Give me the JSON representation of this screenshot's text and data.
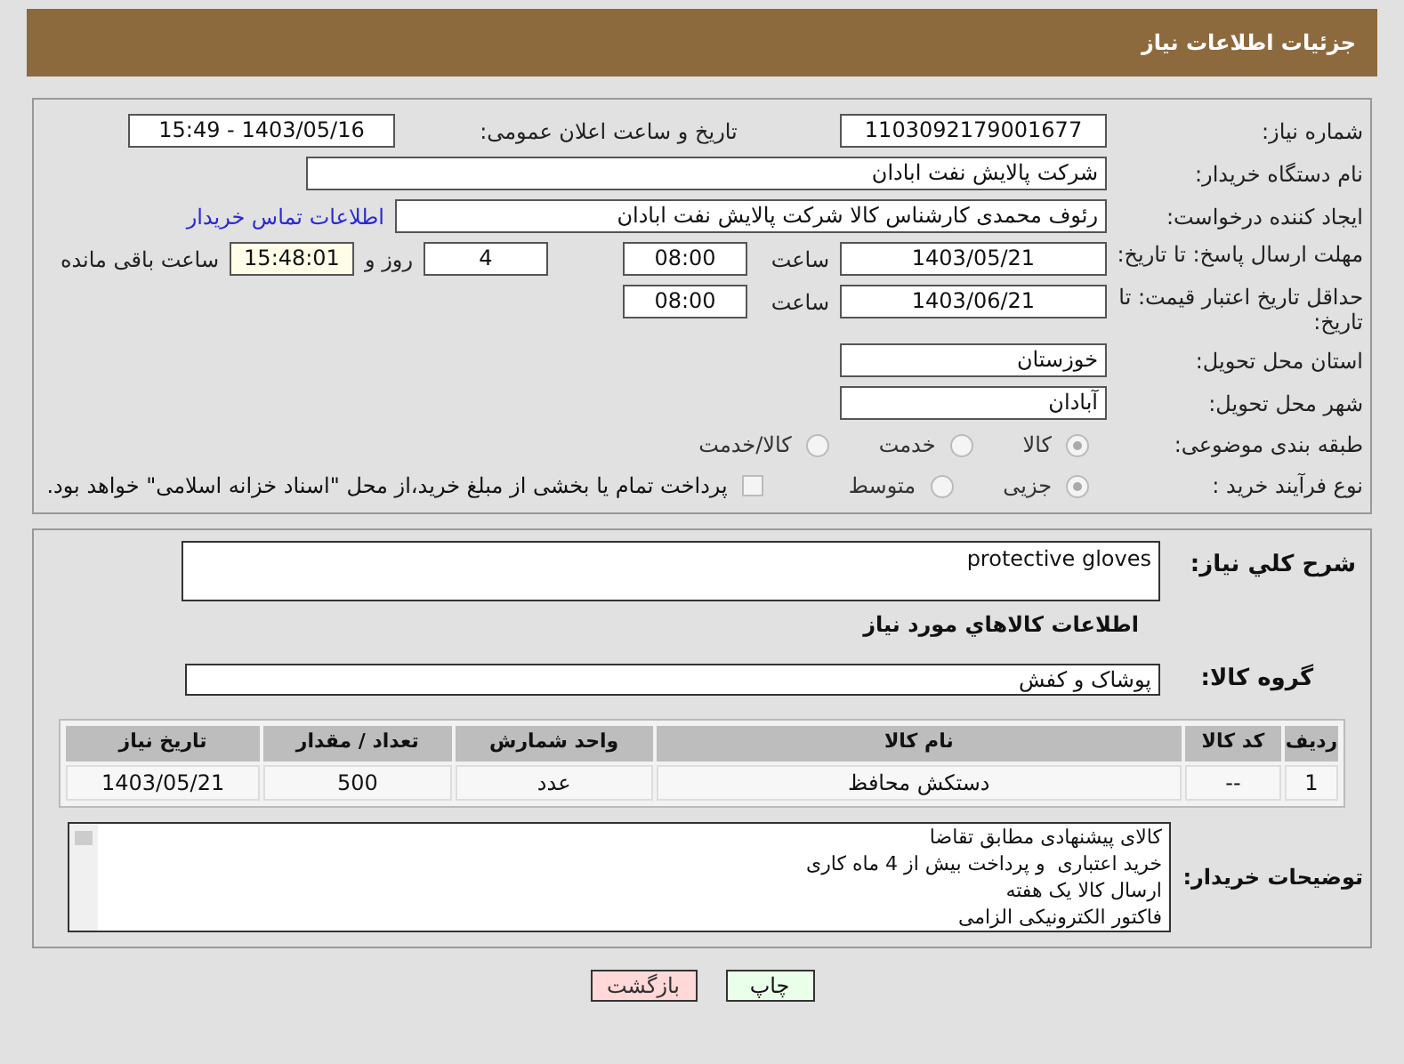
{
  "header": {
    "title": "جزئیات اطلاعات نیاز"
  },
  "details": {
    "need_number": {
      "label": "شماره نیاز:",
      "value": "1103092179001677"
    },
    "announce": {
      "label": "تاریخ و ساعت اعلان عمومی:",
      "value": "1403/05/16 - 15:49"
    },
    "buyer": {
      "label": "نام دستگاه خریدار:",
      "value": "شرکت پالایش نفت ابادان"
    },
    "creator": {
      "label": "ایجاد کننده درخواست:",
      "value": "رئوف محمدی کارشناس کالا شرکت پالایش نفت ابادان",
      "link": "اطلاعات تماس خریدار"
    },
    "deadline": {
      "label": "مهلت ارسال پاسخ: تا تاریخ:",
      "date": "1403/05/21",
      "time_label": "ساعت",
      "time": "08:00",
      "days": "4",
      "days_label": "روز و",
      "remaining": "15:48:01",
      "remaining_label": "ساعت باقی مانده"
    },
    "validity": {
      "label": "حداقل تاریخ اعتبار قیمت: تا تاریخ:",
      "date": "1403/06/21",
      "time_label": "ساعت",
      "time": "08:00"
    },
    "province": {
      "label": "استان محل تحویل:",
      "value": "خوزستان"
    },
    "city": {
      "label": "شهر محل تحویل:",
      "value": "آبادان"
    },
    "category": {
      "label": "طبقه بندی موضوعی:",
      "options": [
        {
          "label": "کالا",
          "selected": true
        },
        {
          "label": "خدمت",
          "selected": false
        },
        {
          "label": "کالا/خدمت",
          "selected": false
        }
      ]
    },
    "process": {
      "label": "نوع فرآیند خرید :",
      "options": [
        {
          "label": "جزیی",
          "selected": true
        },
        {
          "label": "متوسط",
          "selected": false
        }
      ],
      "treasury": {
        "label": "پرداخت تمام یا بخشی از مبلغ خرید،از محل \"اسناد خزانه اسلامی\" خواهد بود.",
        "checked": false
      }
    }
  },
  "items": {
    "description": {
      "label": "شرح كلي نياز:",
      "value": "protective gloves"
    },
    "heading": "اطلاعات كالاهاي مورد نياز",
    "group": {
      "label": "گروه کالا:",
      "value": "پوشاک و کفش"
    },
    "table": {
      "columns": [
        "ردیف",
        "کد کالا",
        "نام کالا",
        "واحد شمارش",
        "تعداد / مقدار",
        "تاریخ نیاز"
      ],
      "rows": [
        [
          "1",
          "--",
          "دستکش محافظ",
          "عدد",
          "500",
          "1403/05/21"
        ]
      ]
    },
    "notes": {
      "label": "توضیحات خریدار:",
      "lines": [
        "کالای پیشنهادی مطابق تقاضا",
        "خرید اعتباری  و پرداخت بیش از 4 ماه کاری",
        "ارسال کالا یک هفته",
        "فاکتور الکترونیکی الزامی"
      ]
    }
  },
  "buttons": [
    {
      "label": "چاپ",
      "kind": "print"
    },
    {
      "label": "بازگشت",
      "kind": "back"
    }
  ]
}
